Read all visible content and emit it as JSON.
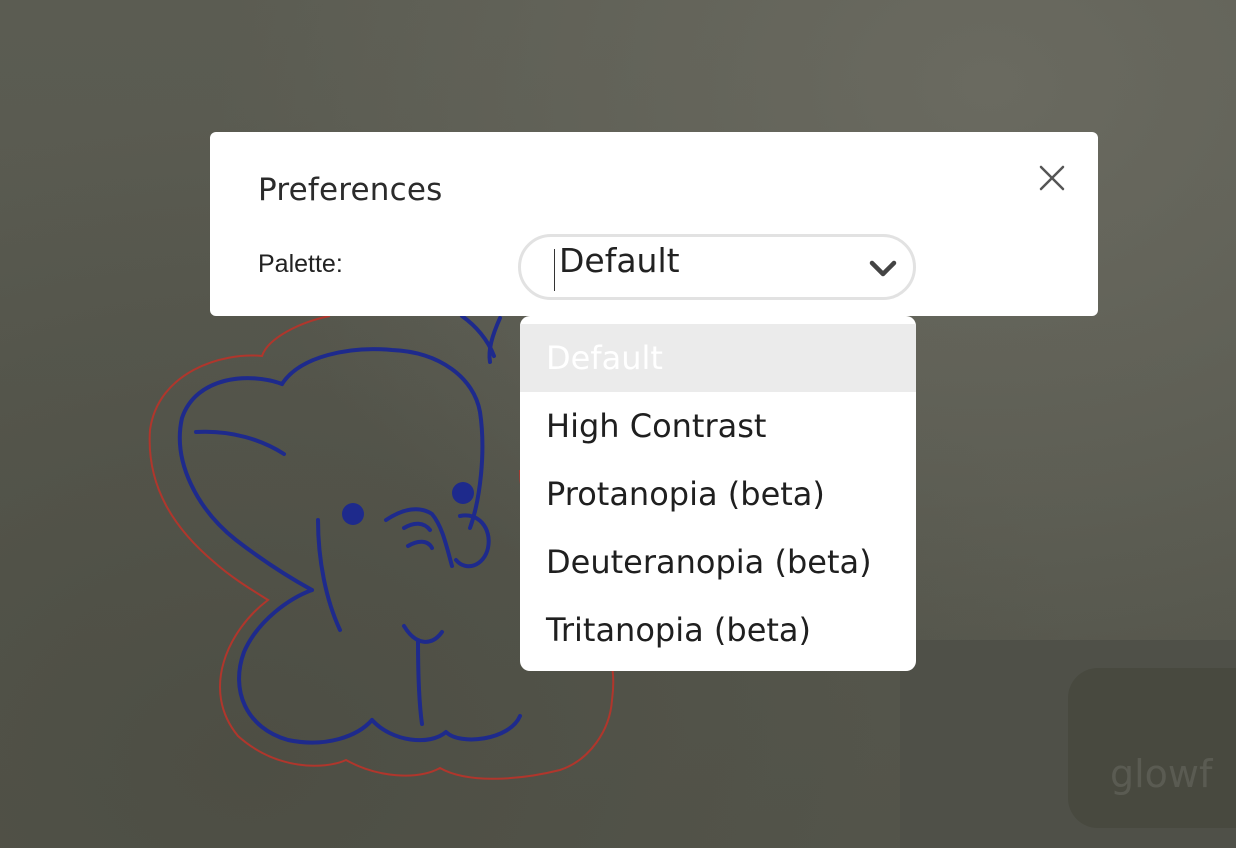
{
  "dialog": {
    "title": "Preferences",
    "close_icon": "close-icon"
  },
  "palette": {
    "label": "Palette:",
    "selected": "Default",
    "options": [
      "Default",
      "High Contrast",
      "Protanopia (beta)",
      "Deuteranopia (beta)",
      "Tritanopia (beta)"
    ],
    "highlighted_index": 0
  },
  "background": {
    "logo_text": "glowf"
  },
  "colors": {
    "overlay": "#595a4f",
    "illustration_outline": "#1e2a8c",
    "illustration_cut_line": "#b0362c",
    "option_highlight": "#ebebeb"
  }
}
